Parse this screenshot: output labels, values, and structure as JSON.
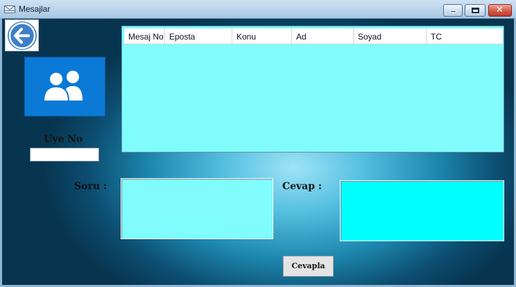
{
  "window": {
    "title": "Mesajlar",
    "icons": {
      "app": "envelope-icon",
      "minimize": "minimize-icon",
      "maximize": "maximize-icon",
      "close": "close-icon"
    }
  },
  "back_button": {
    "icon": "arrow-left-icon",
    "color": "#3e80c8"
  },
  "user_picture": {
    "icon": "users-icon",
    "color": "#0a7ad6"
  },
  "uye_no": {
    "label": "Uye No",
    "value": ""
  },
  "grid": {
    "columns": [
      "Mesaj No",
      "Eposta",
      "Konu",
      "Ad",
      "Soyad",
      "TC"
    ],
    "rows": [],
    "background": "#80fcfc"
  },
  "soru": {
    "label": "Soru :",
    "value": ""
  },
  "cevap": {
    "label": "Cevap :",
    "value": ""
  },
  "actions": {
    "cevapla_label": "Cevapla"
  }
}
